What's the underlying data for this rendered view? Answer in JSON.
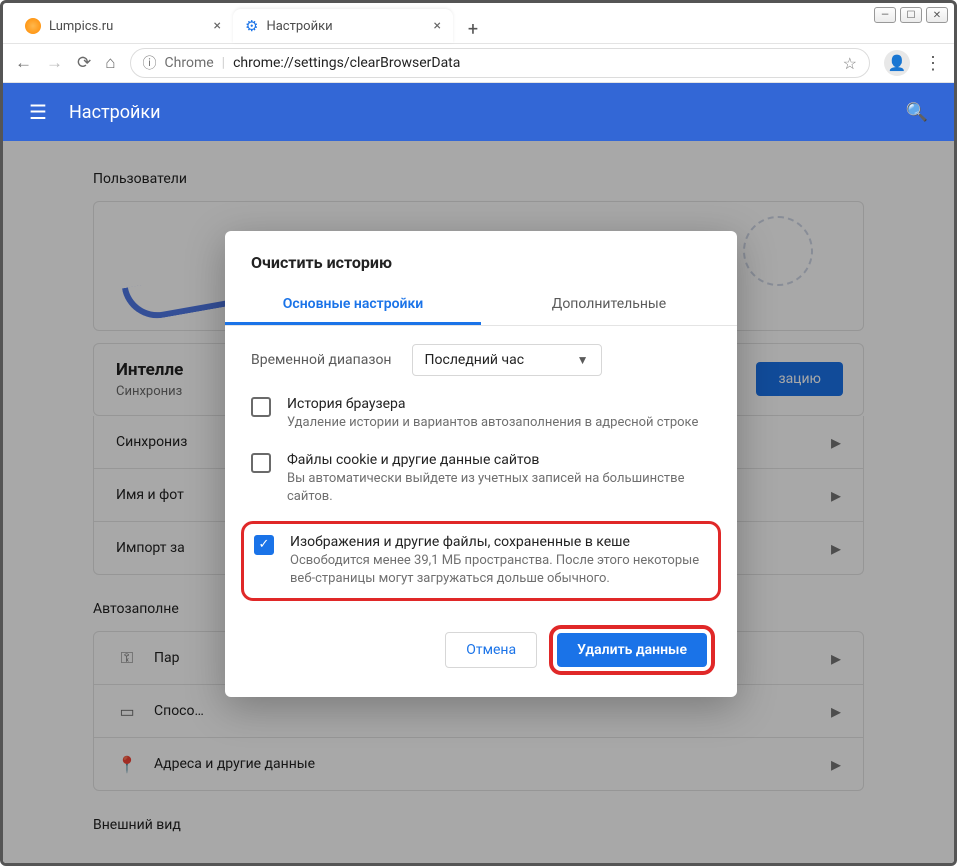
{
  "window": {
    "min": "—",
    "max": "☐",
    "close": "✕"
  },
  "tabs": [
    {
      "favicon": "orange",
      "title": "Lumpics.ru"
    },
    {
      "favicon": "gear",
      "title": "Настройки"
    }
  ],
  "address": {
    "origin": "Chrome",
    "path": "chrome://settings/clearBrowserData"
  },
  "header": {
    "title": "Настройки"
  },
  "sections": {
    "users_title": "Пользователи",
    "intel_title": "Интелле",
    "intel_sub": "Синхрониз",
    "button_suffix": "зацию",
    "rows": [
      "Синхрониз",
      "Имя и фот",
      "Импорт за"
    ],
    "autofill_title": "Автозаполне",
    "autofill_rows": [
      {
        "icon": "🔑",
        "label": "Пар"
      },
      {
        "icon": "💳",
        "label": "Спосо…"
      },
      {
        "icon": "📍",
        "label": "Адреса и другие данные"
      }
    ],
    "appearance_title": "Внешний вид"
  },
  "modal": {
    "title": "Очистить историю",
    "tab_basic": "Основные настройки",
    "tab_advanced": "Дополнительные",
    "range_label": "Временной диапазон",
    "range_value": "Последний час",
    "options": [
      {
        "checked": false,
        "title": "История браузера",
        "desc": "Удаление истории и вариантов автозаполнения в адресной строке",
        "highlight": false
      },
      {
        "checked": false,
        "title": "Файлы cookie и другие данные сайтов",
        "desc": "Вы автоматически выйдете из учетных записей на большинстве сайтов.",
        "highlight": false
      },
      {
        "checked": true,
        "title": "Изображения и другие файлы, сохраненные в кеше",
        "desc": "Освободится менее 39,1 МБ пространства. После этого некоторые веб-страницы могут загружаться дольше обычного.",
        "highlight": true
      }
    ],
    "cancel": "Отмена",
    "confirm": "Удалить данные"
  }
}
